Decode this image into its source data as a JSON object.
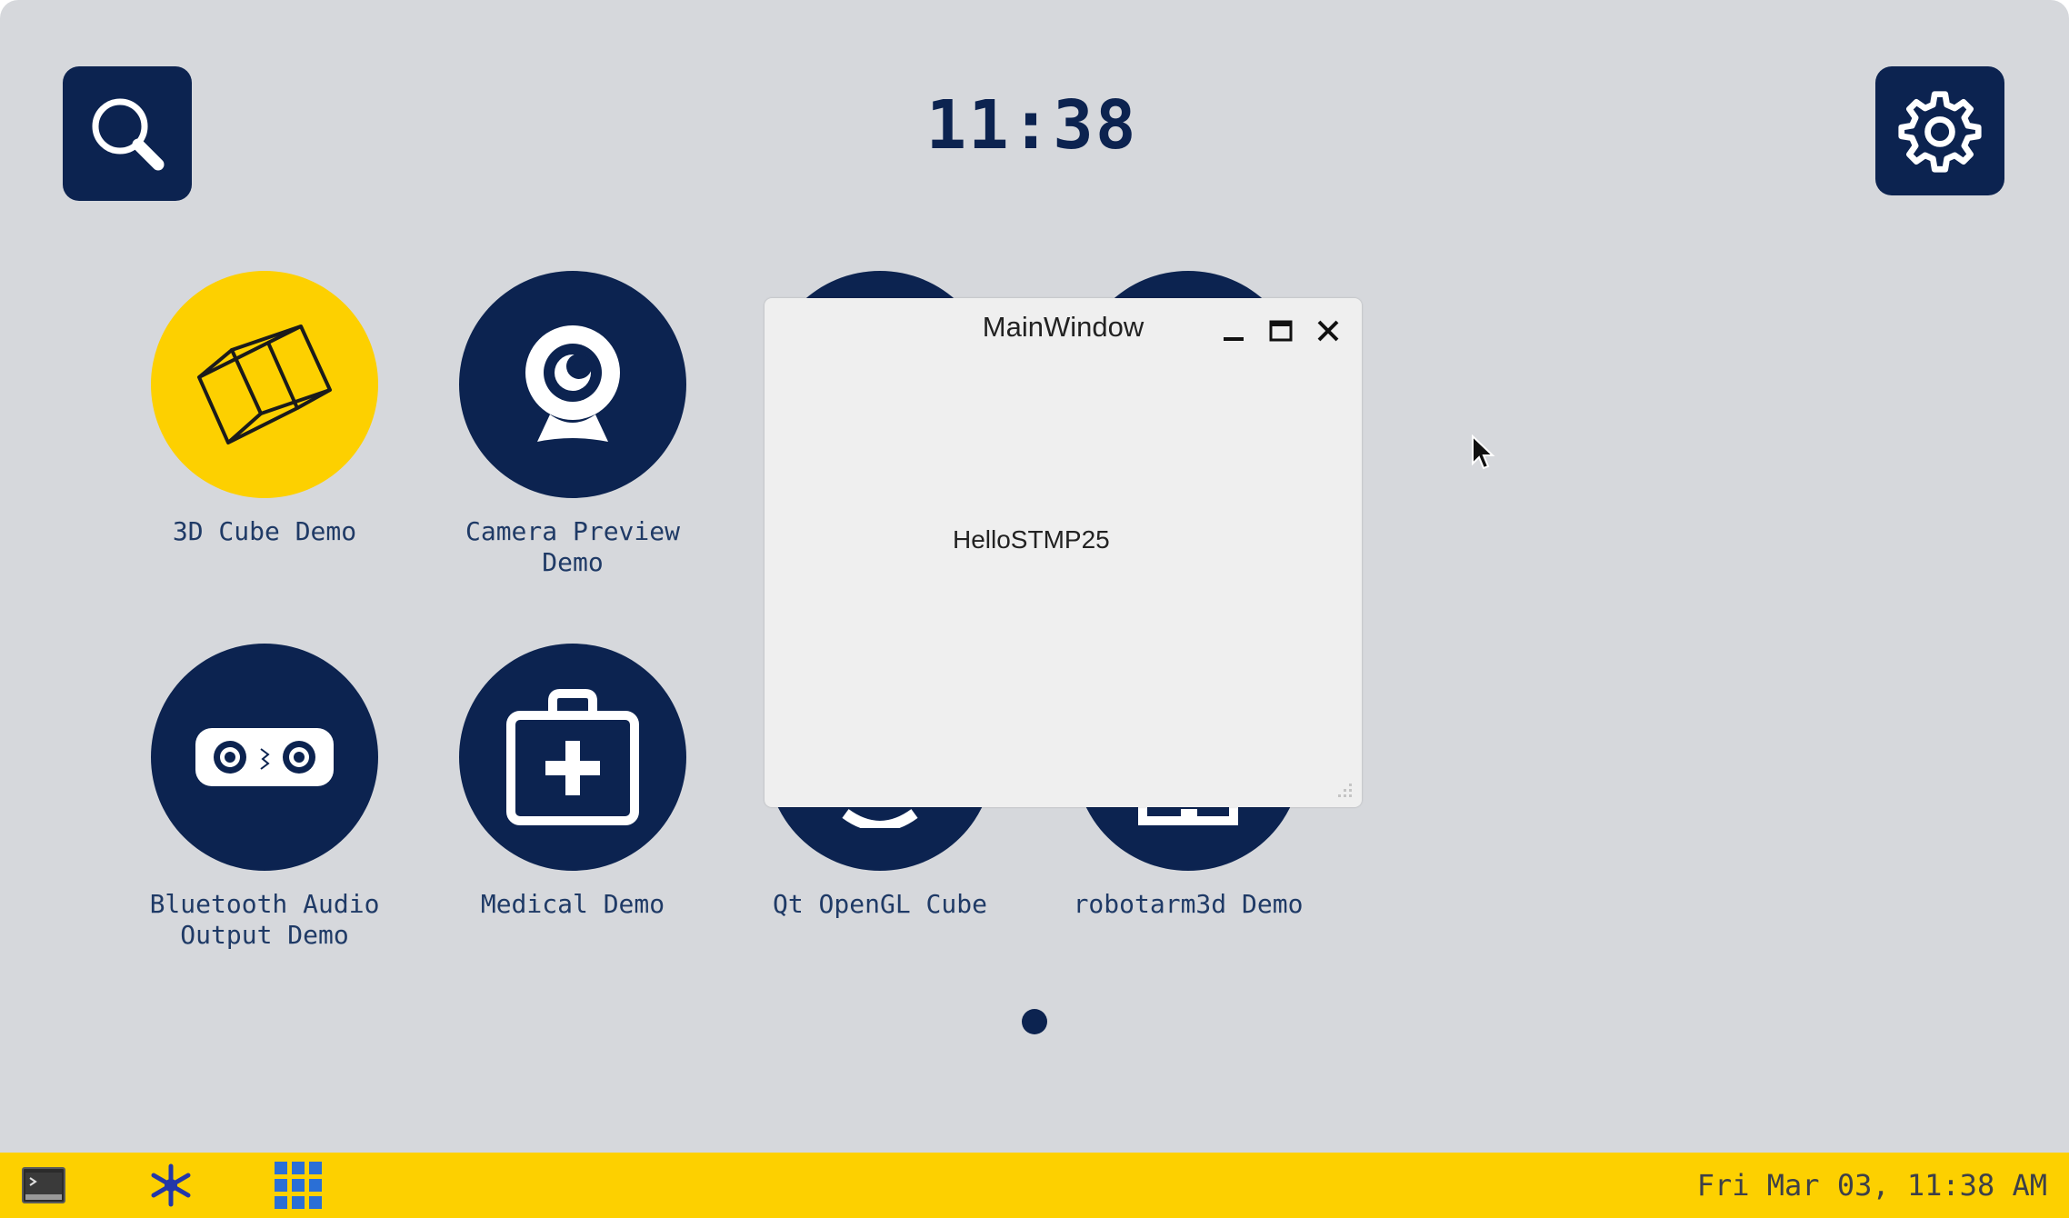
{
  "header": {
    "clock": "11:38",
    "search_icon": "search-icon",
    "settings_icon": "gear-icon"
  },
  "apps": [
    {
      "label": "3D Cube Demo",
      "icon": "cube-icon",
      "highlighted": true
    },
    {
      "label": "Camera Preview\nDemo",
      "icon": "webcam-icon",
      "highlighted": false
    },
    {
      "label": "",
      "icon": "hidden-app-icon",
      "highlighted": false
    },
    {
      "label": "",
      "icon": "hidden-app-icon",
      "highlighted": false
    },
    {
      "label": "Bluetooth Audio\nOutput Demo",
      "icon": "speaker-icon",
      "highlighted": false
    },
    {
      "label": "Medical Demo",
      "icon": "medical-kit-icon",
      "highlighted": false
    },
    {
      "label": "Qt OpenGL Cube",
      "icon": "qt-icon",
      "highlighted": false
    },
    {
      "label": "robotarm3d Demo",
      "icon": "robot-arm-icon",
      "highlighted": false
    }
  ],
  "pager": {
    "current_page": 1,
    "total_pages": 1
  },
  "window": {
    "title": "MainWindow",
    "content": "HelloSTMP25",
    "controls": [
      "minimize-icon",
      "maximize-icon",
      "close-icon"
    ]
  },
  "taskbar": {
    "datetime": "Fri Mar 03, 11:38 AM",
    "icons": [
      "terminal-icon",
      "asterisk-icon",
      "app-grid-icon"
    ]
  },
  "colors": {
    "background": "#d6d8dc",
    "navy": "#0c2350",
    "accent_yellow": "#fdd000",
    "label_text": "#1f3a66",
    "window_bg": "#efefef"
  }
}
